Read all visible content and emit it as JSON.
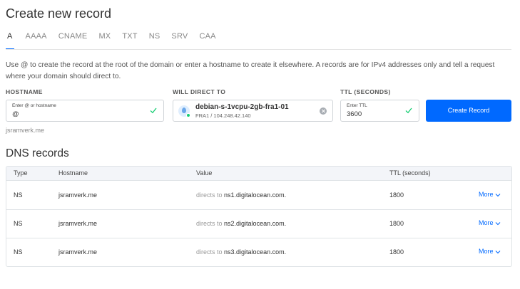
{
  "page": {
    "title": "Create new record"
  },
  "tabs": [
    {
      "label": "A",
      "active": true
    },
    {
      "label": "AAAA"
    },
    {
      "label": "CNAME"
    },
    {
      "label": "MX"
    },
    {
      "label": "TXT"
    },
    {
      "label": "NS"
    },
    {
      "label": "SRV"
    },
    {
      "label": "CAA"
    }
  ],
  "description": "Use @ to create the record at the root of the domain or enter a hostname to create it elsewhere. A records are for IPv4 addresses only and tell a request where your domain should direct to.",
  "form": {
    "hostname": {
      "label": "HOSTNAME",
      "placeholder": "Enter @ or hostname",
      "value": "@"
    },
    "direct": {
      "label": "WILL DIRECT TO",
      "name": "debian-s-1vcpu-2gb-fra1-01",
      "sub": "FRA1 / 104.248.42.140"
    },
    "ttl": {
      "label": "TTL (SECONDS)",
      "placeholder": "Enter TTL",
      "value": "3600"
    },
    "create_label": "Create Record",
    "domain_hint": "jsramverk.me"
  },
  "dns": {
    "title": "DNS records",
    "columns": {
      "type": "Type",
      "hostname": "Hostname",
      "value": "Value",
      "ttl": "TTL (seconds)"
    },
    "rows": [
      {
        "type": "NS",
        "hostname": "jsramverk.me",
        "prefix": "directs to",
        "value": "ns1.digitalocean.com.",
        "ttl": "1800",
        "more": "More"
      },
      {
        "type": "NS",
        "hostname": "jsramverk.me",
        "prefix": "directs to",
        "value": "ns2.digitalocean.com.",
        "ttl": "1800",
        "more": "More"
      },
      {
        "type": "NS",
        "hostname": "jsramverk.me",
        "prefix": "directs to",
        "value": "ns3.digitalocean.com.",
        "ttl": "1800",
        "more": "More"
      }
    ]
  },
  "colors": {
    "accent": "#0069ff",
    "check": "#15cd72"
  }
}
